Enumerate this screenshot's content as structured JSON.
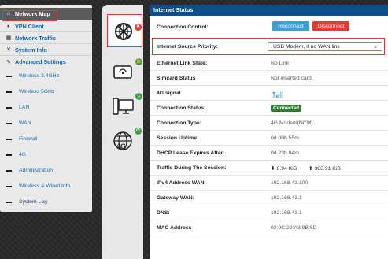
{
  "sidebar": {
    "items": [
      {
        "label": "Network Map",
        "icon": "home-icon",
        "active": true
      },
      {
        "label": "VPN Client",
        "icon": "vpn-icon"
      },
      {
        "label": "Network Traffic",
        "icon": "traffic-icon"
      },
      {
        "label": "System Info",
        "icon": "system-info-icon"
      },
      {
        "label": "Advanced Settings",
        "icon": "wrench-icon"
      }
    ],
    "sub_items": [
      {
        "label": "Wireless 2.4GHz"
      },
      {
        "label": "Wireless 5GHz"
      },
      {
        "label": "LAN"
      },
      {
        "label": "WAN"
      },
      {
        "label": "Firewall"
      },
      {
        "label": "4G"
      },
      {
        "label": "Administration"
      },
      {
        "label": "Wireless & Wired Info"
      },
      {
        "label": "System Log"
      }
    ]
  },
  "icons": {
    "internet": {
      "name": "internet-globe-icon",
      "badge": "✖",
      "badge_color": "#e53935"
    },
    "router": {
      "name": "router-icon",
      "badge": "🔒",
      "badge_color": "#43a047"
    },
    "clients": {
      "name": "clients-icon",
      "badge": "1",
      "badge_color": "#43a047"
    },
    "lte": {
      "name": "4g-globe-icon",
      "label": "4G",
      "badge": "⟳",
      "badge_color": "#43a047"
    }
  },
  "main": {
    "title": "Internet Status",
    "connection_control_label": "Connection Control:",
    "reconnect_label": "Reconnect",
    "disconnect_label": "Disconnect",
    "source_priority_label": "Internet Source Priority:",
    "source_priority_value": "USB Modem, if no WAN link",
    "rows": [
      {
        "label": "Ethernet Link State:",
        "value": "No Link"
      },
      {
        "label": "Simcard Status",
        "value": "Not inserted card"
      },
      {
        "label": "4G signal",
        "value": ""
      },
      {
        "label": "Connection Status:",
        "value": "Connected"
      },
      {
        "label": "Connection Type:",
        "value": "4G Modem(NCM)"
      },
      {
        "label": "Session Uptime:",
        "value": "0d 00h 55m"
      },
      {
        "label": "DHCP Lease Expires After:",
        "value": "0d 23h 04m"
      },
      {
        "label": "Traffic During The Session:",
        "down": "8.94 KiB",
        "up": "388.91 KiB"
      },
      {
        "label": "IPv4 Address WAN:",
        "value": "192.168.43.100"
      },
      {
        "label": "Gateway WAN:",
        "value": "192.168.43.1"
      },
      {
        "label": "DNS:",
        "value": "192.168.43.1"
      },
      {
        "label": "MAC Address",
        "value": "02:0C:29:A3:9B:6D"
      }
    ]
  },
  "colors": {
    "accent": "#0d4f8a",
    "reconnect": "#3aa0d8",
    "disconnect": "#e53935",
    "connected": "#2e7d32",
    "highlight": "#e53935"
  }
}
